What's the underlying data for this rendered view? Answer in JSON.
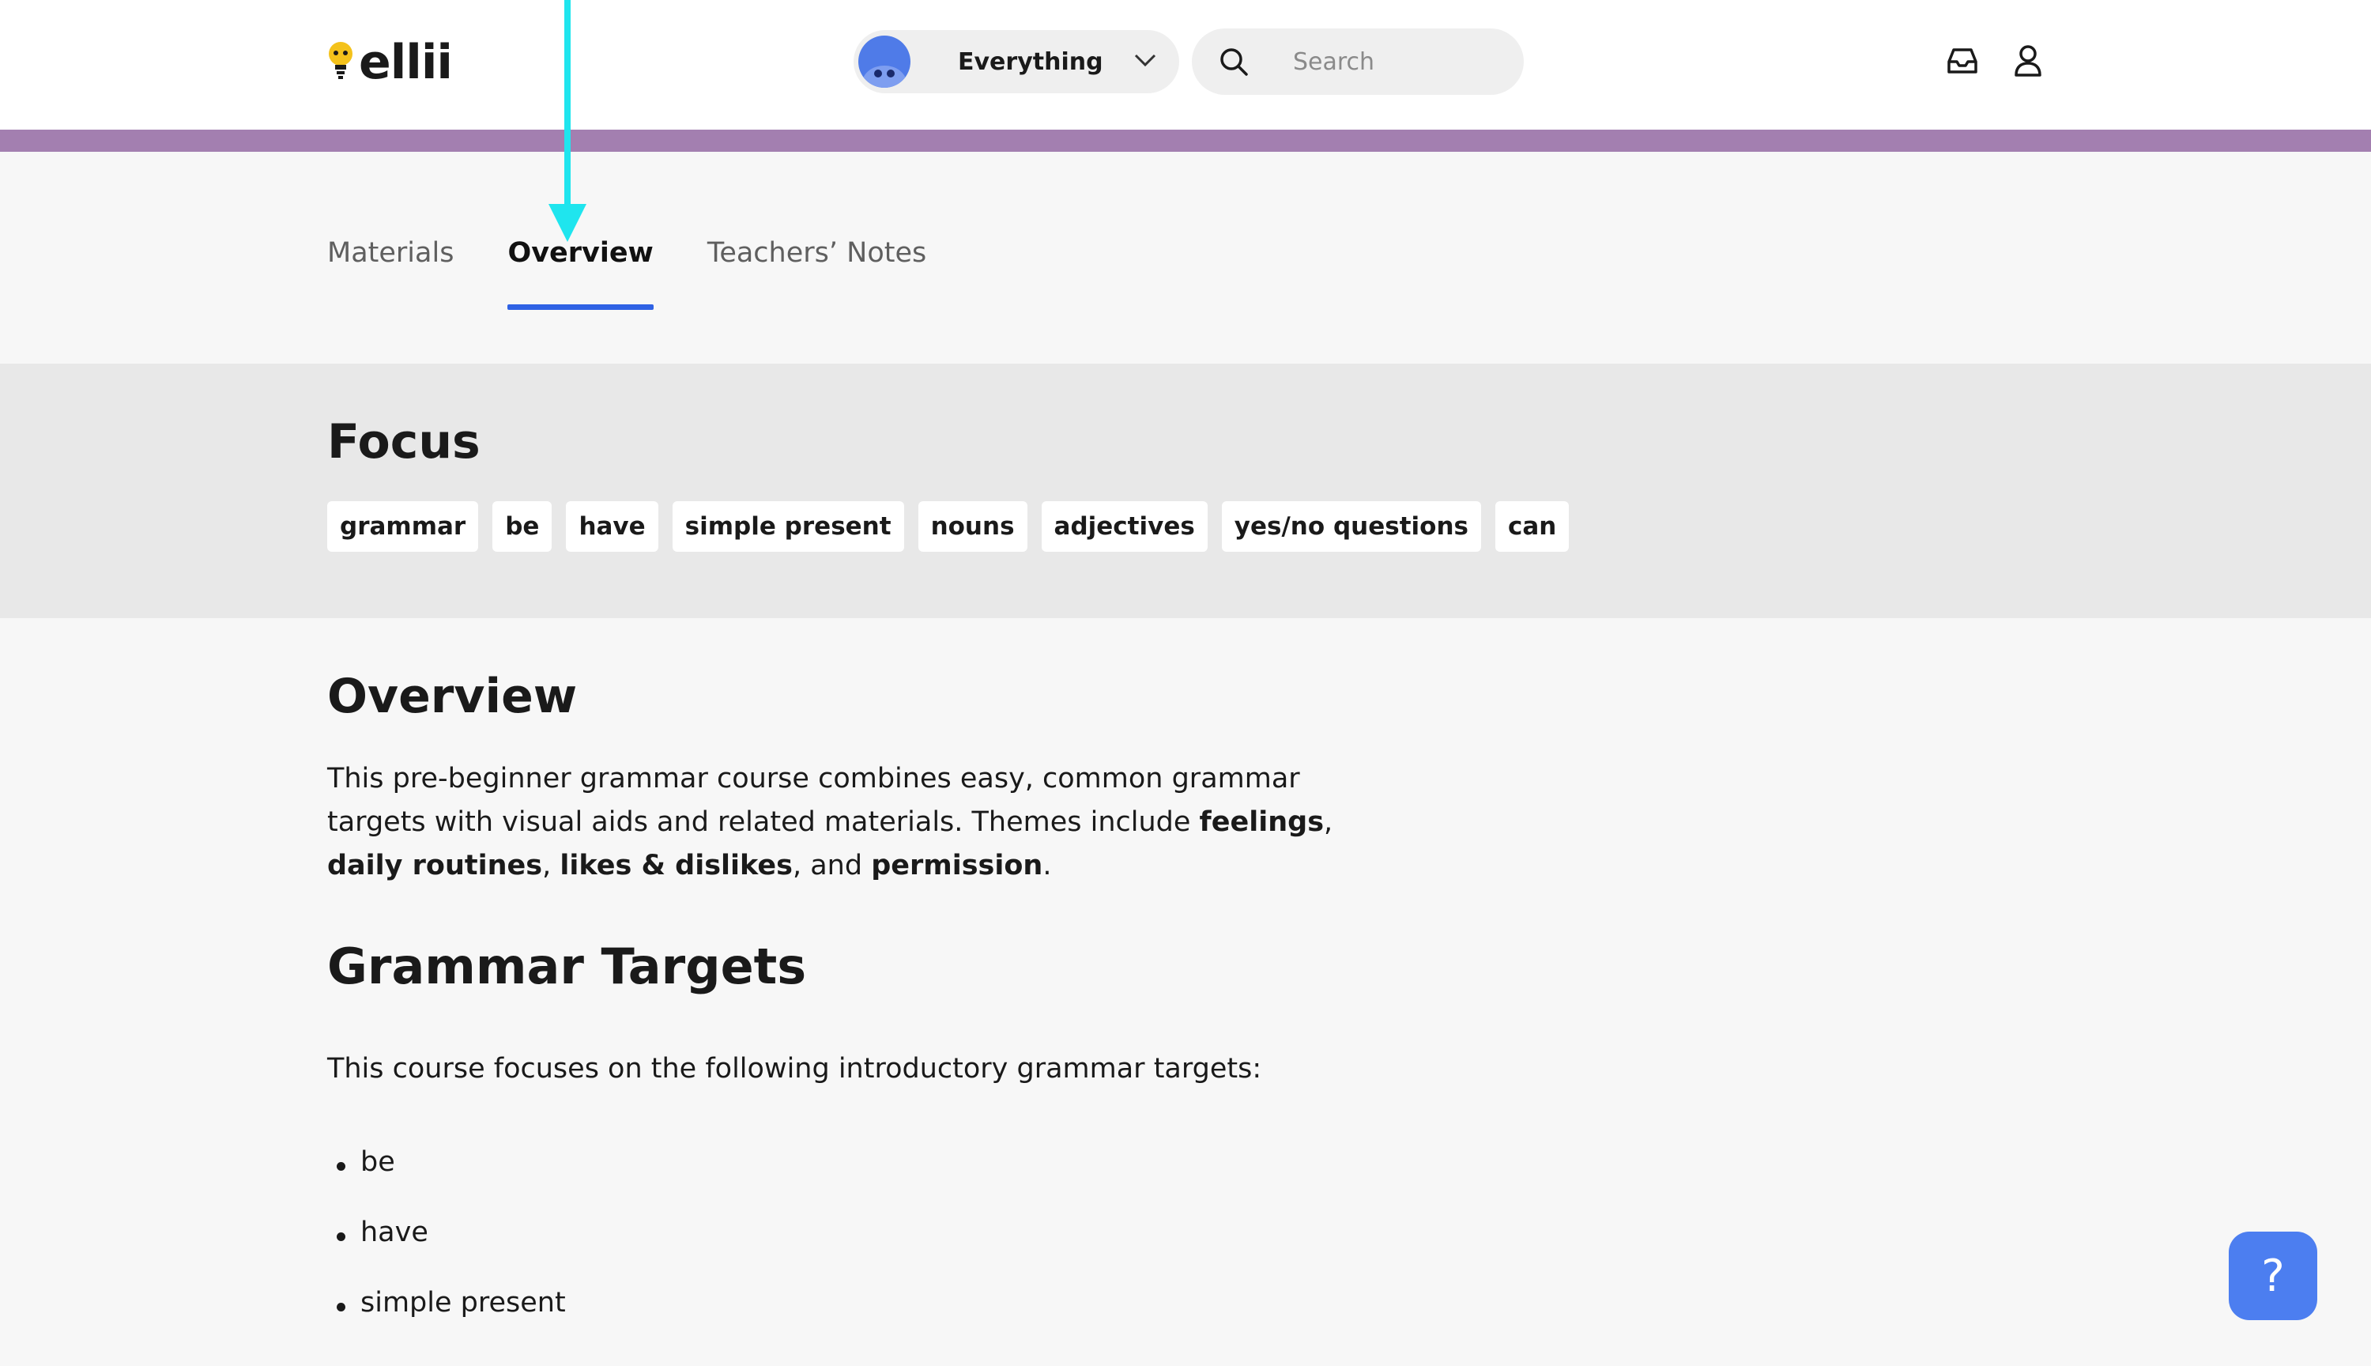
{
  "header": {
    "logo_text": "ellii",
    "scope_label": "Everything",
    "search_placeholder": "Search"
  },
  "tabs": [
    {
      "label": "Materials",
      "active": false
    },
    {
      "label": "Overview",
      "active": true
    },
    {
      "label": "Teachers’ Notes",
      "active": false
    }
  ],
  "focus": {
    "title": "Focus",
    "tags": [
      "grammar",
      "be",
      "have",
      "simple present",
      "nouns",
      "adjectives",
      "yes/no questions",
      "can"
    ]
  },
  "overview": {
    "title": "Overview",
    "text_1": "This pre-beginner grammar course combines easy, common grammar targets with visual aids and related materials. Themes include ",
    "bold_1": "feelings",
    "sep_1": ", ",
    "bold_2": "daily routines",
    "sep_2": ", ",
    "bold_3": "likes & dislikes",
    "sep_3": ", and ",
    "bold_4": "permission",
    "end": "."
  },
  "grammar_targets": {
    "title": "Grammar Targets",
    "intro": "This course focuses on the following introductory grammar targets:",
    "items": [
      "be",
      "have",
      "simple present"
    ]
  },
  "help": {
    "label": "?"
  },
  "colors": {
    "accent_bar": "#a37fb0",
    "tab_underline": "#2f62e4",
    "help_button": "#4c7ef0",
    "annotation_arrow": "#1fe5ee"
  },
  "icons": [
    "bulb-logo-icon",
    "avatar-icon",
    "chevron-down-icon",
    "search-icon",
    "inbox-icon",
    "user-icon",
    "annotation-arrow"
  ]
}
